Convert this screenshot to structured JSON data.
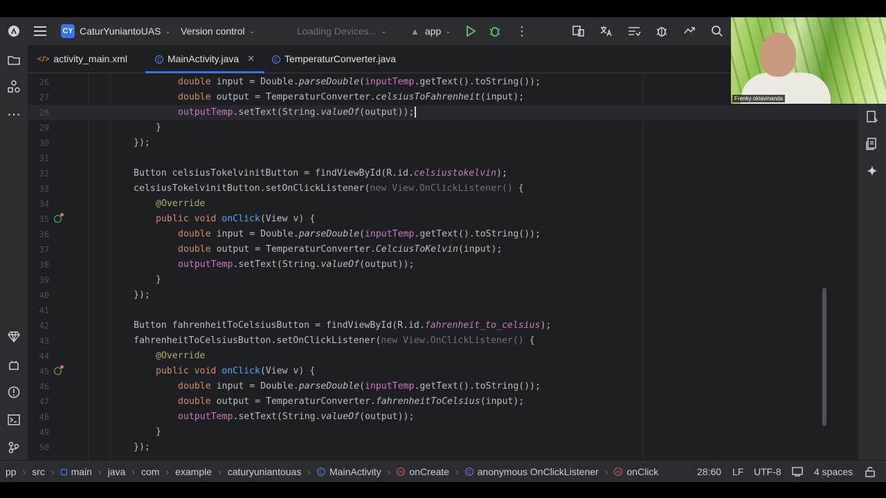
{
  "toolbar": {
    "project_badge": "CY",
    "project_name": "CaturYuniantoUAS",
    "vcs": "Version control",
    "device": "Loading Devices...",
    "run_config": "app"
  },
  "tabs": [
    {
      "label": "activity_main.xml",
      "icon": "xml-icon"
    },
    {
      "label": "MainActivity.java",
      "icon": "class-icon",
      "active": true
    },
    {
      "label": "TemperaturConverter.java",
      "icon": "class-icon"
    }
  ],
  "code": {
    "lines": [
      {
        "n": "26",
        "indent": 2,
        "parts": [
          [
            "kw",
            "double "
          ],
          [
            "tx",
            "input = Double."
          ],
          [
            "st",
            "parseDouble"
          ],
          [
            "tx",
            "("
          ],
          [
            "fld",
            "inputTemp"
          ],
          [
            "tx",
            ".getText().toString());"
          ]
        ]
      },
      {
        "n": "27",
        "indent": 2,
        "parts": [
          [
            "kw",
            "double "
          ],
          [
            "tx",
            "output = TemperaturConverter."
          ],
          [
            "st",
            "celsiusToFahrenheit"
          ],
          [
            "tx",
            "(input);"
          ]
        ]
      },
      {
        "n": "28",
        "indent": 2,
        "current": true,
        "parts": [
          [
            "fld",
            "outputTemp"
          ],
          [
            "tx",
            ".setText(String."
          ],
          [
            "st",
            "valueOf"
          ],
          [
            "tx",
            "(output));"
          ]
        ]
      },
      {
        "n": "29",
        "indent": 1,
        "parts": [
          [
            "tx",
            "}"
          ]
        ]
      },
      {
        "n": "30",
        "indent": 0,
        "parts": [
          [
            "tx",
            "});"
          ]
        ]
      },
      {
        "n": "31",
        "indent": 0,
        "parts": []
      },
      {
        "n": "32",
        "indent": 0,
        "parts": [
          [
            "tx",
            "Button celsiusTokelvinitButton = findViewById(R.id."
          ],
          [
            "res",
            "celsiustokelvin"
          ],
          [
            "tx",
            ");"
          ]
        ]
      },
      {
        "n": "33",
        "indent": 0,
        "parts": [
          [
            "tx",
            "celsiusTokelvinitButton.setOnClickListener("
          ],
          [
            "dim",
            "new View.OnClickListener() "
          ],
          [
            "tx",
            "{"
          ]
        ]
      },
      {
        "n": "34",
        "indent": 1,
        "parts": [
          [
            "ann",
            "@Override"
          ]
        ]
      },
      {
        "n": "35",
        "indent": 1,
        "gutter": true,
        "parts": [
          [
            "kw",
            "public void "
          ],
          [
            "mth",
            "onClick"
          ],
          [
            "tx",
            "(View v) {"
          ]
        ]
      },
      {
        "n": "36",
        "indent": 2,
        "parts": [
          [
            "kw",
            "double "
          ],
          [
            "tx",
            "input = Double."
          ],
          [
            "st",
            "parseDouble"
          ],
          [
            "tx",
            "("
          ],
          [
            "fld",
            "inputTemp"
          ],
          [
            "tx",
            ".getText().toString());"
          ]
        ]
      },
      {
        "n": "37",
        "indent": 2,
        "parts": [
          [
            "kw",
            "double "
          ],
          [
            "tx",
            "output = TemperaturConverter."
          ],
          [
            "st",
            "CelciusToKelvin"
          ],
          [
            "tx",
            "(input);"
          ]
        ]
      },
      {
        "n": "38",
        "indent": 2,
        "parts": [
          [
            "fld",
            "outputTemp"
          ],
          [
            "tx",
            ".setText(String."
          ],
          [
            "st",
            "valueOf"
          ],
          [
            "tx",
            "(output));"
          ]
        ]
      },
      {
        "n": "39",
        "indent": 1,
        "parts": [
          [
            "tx",
            "}"
          ]
        ]
      },
      {
        "n": "40",
        "indent": 0,
        "parts": [
          [
            "tx",
            "});"
          ]
        ]
      },
      {
        "n": "41",
        "indent": 0,
        "parts": []
      },
      {
        "n": "42",
        "indent": 0,
        "parts": [
          [
            "tx",
            "Button fahrenheitToCelsiusButton = findViewById(R.id."
          ],
          [
            "res",
            "fahrenheit_to_celsius"
          ],
          [
            "tx",
            ");"
          ]
        ]
      },
      {
        "n": "43",
        "indent": 0,
        "parts": [
          [
            "tx",
            "fahrenheitToCelsiusButton.setOnClickListener("
          ],
          [
            "dim",
            "new View.OnClickListener() "
          ],
          [
            "tx",
            "{"
          ]
        ]
      },
      {
        "n": "44",
        "indent": 1,
        "parts": [
          [
            "ann",
            "@Override"
          ]
        ]
      },
      {
        "n": "45",
        "indent": 1,
        "gutter": true,
        "parts": [
          [
            "kw",
            "public void "
          ],
          [
            "mth",
            "onClick"
          ],
          [
            "tx",
            "(View v) {"
          ]
        ]
      },
      {
        "n": "46",
        "indent": 2,
        "parts": [
          [
            "kw",
            "double "
          ],
          [
            "tx",
            "input = Double."
          ],
          [
            "st",
            "parseDouble"
          ],
          [
            "tx",
            "("
          ],
          [
            "fld",
            "inputTemp"
          ],
          [
            "tx",
            ".getText().toString());"
          ]
        ]
      },
      {
        "n": "47",
        "indent": 2,
        "parts": [
          [
            "kw",
            "double "
          ],
          [
            "tx",
            "output = TemperaturConverter."
          ],
          [
            "st",
            "fahrenheitToCelsius"
          ],
          [
            "tx",
            "(input);"
          ]
        ]
      },
      {
        "n": "48",
        "indent": 2,
        "parts": [
          [
            "fld",
            "outputTemp"
          ],
          [
            "tx",
            ".setText(String."
          ],
          [
            "st",
            "valueOf"
          ],
          [
            "tx",
            "(output));"
          ]
        ]
      },
      {
        "n": "49",
        "indent": 1,
        "parts": [
          [
            "tx",
            "}"
          ]
        ]
      },
      {
        "n": "50",
        "indent": 0,
        "parts": [
          [
            "tx",
            "});"
          ]
        ]
      }
    ]
  },
  "breadcrumbs": [
    {
      "label": "pp",
      "icon": ""
    },
    {
      "label": "src",
      "icon": ""
    },
    {
      "label": "main",
      "icon": "module-icon"
    },
    {
      "label": "java",
      "icon": ""
    },
    {
      "label": "com",
      "icon": ""
    },
    {
      "label": "example",
      "icon": ""
    },
    {
      "label": "caturyuniantouas",
      "icon": ""
    },
    {
      "label": "MainActivity",
      "icon": "class-icon"
    },
    {
      "label": "onCreate",
      "icon": "method-icon"
    },
    {
      "label": "anonymous OnClickListener",
      "icon": "class-icon"
    },
    {
      "label": "onClick",
      "icon": "method-icon"
    }
  ],
  "status": {
    "position": "28:60",
    "line_separator": "LF",
    "encoding": "UTF-8",
    "indent": "4 spaces"
  },
  "webcam": {
    "name": "Frenky oktavinanda"
  }
}
